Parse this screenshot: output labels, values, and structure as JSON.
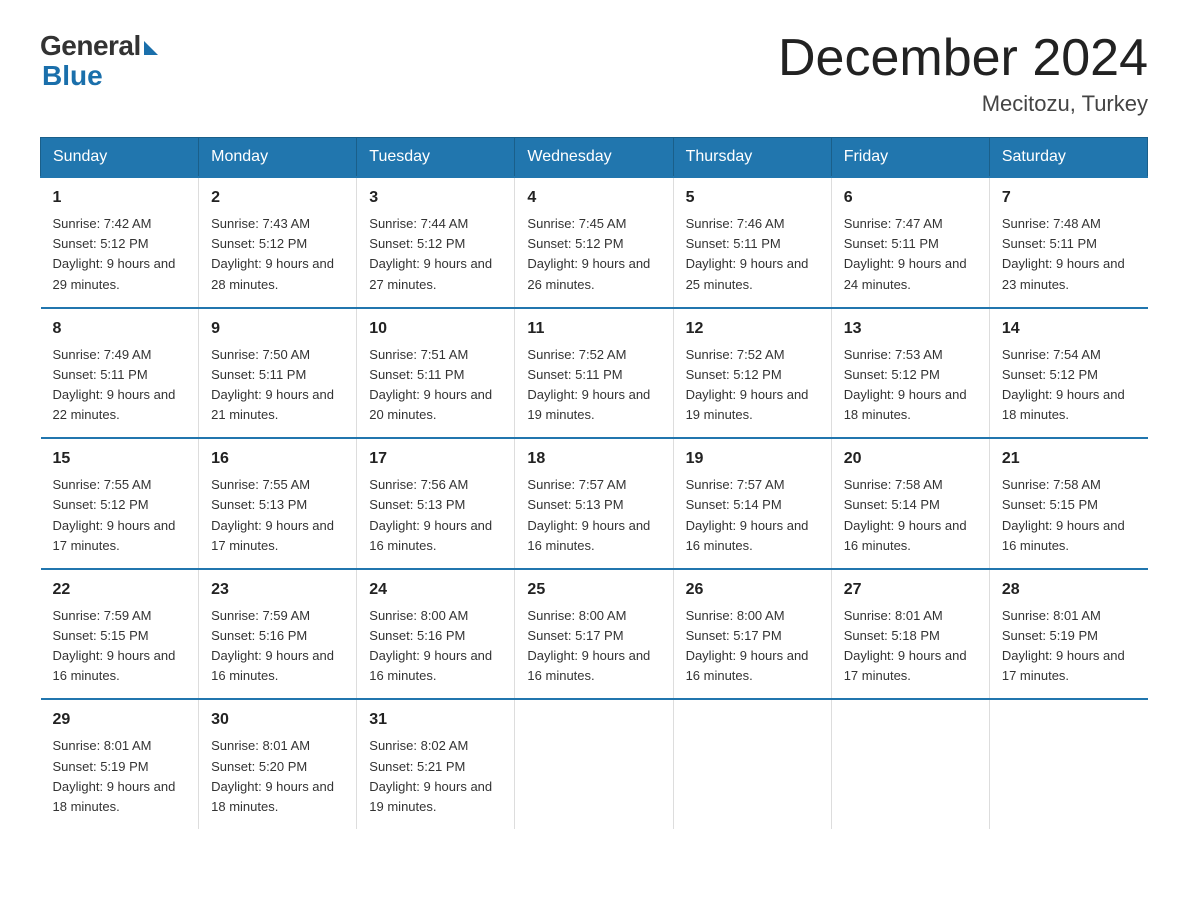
{
  "header": {
    "logo_general": "General",
    "logo_blue": "Blue",
    "title": "December 2024",
    "location": "Mecitozu, Turkey"
  },
  "days_of_week": [
    "Sunday",
    "Monday",
    "Tuesday",
    "Wednesday",
    "Thursday",
    "Friday",
    "Saturday"
  ],
  "weeks": [
    [
      {
        "day": "1",
        "sunrise": "Sunrise: 7:42 AM",
        "sunset": "Sunset: 5:12 PM",
        "daylight": "Daylight: 9 hours and 29 minutes."
      },
      {
        "day": "2",
        "sunrise": "Sunrise: 7:43 AM",
        "sunset": "Sunset: 5:12 PM",
        "daylight": "Daylight: 9 hours and 28 minutes."
      },
      {
        "day": "3",
        "sunrise": "Sunrise: 7:44 AM",
        "sunset": "Sunset: 5:12 PM",
        "daylight": "Daylight: 9 hours and 27 minutes."
      },
      {
        "day": "4",
        "sunrise": "Sunrise: 7:45 AM",
        "sunset": "Sunset: 5:12 PM",
        "daylight": "Daylight: 9 hours and 26 minutes."
      },
      {
        "day": "5",
        "sunrise": "Sunrise: 7:46 AM",
        "sunset": "Sunset: 5:11 PM",
        "daylight": "Daylight: 9 hours and 25 minutes."
      },
      {
        "day": "6",
        "sunrise": "Sunrise: 7:47 AM",
        "sunset": "Sunset: 5:11 PM",
        "daylight": "Daylight: 9 hours and 24 minutes."
      },
      {
        "day": "7",
        "sunrise": "Sunrise: 7:48 AM",
        "sunset": "Sunset: 5:11 PM",
        "daylight": "Daylight: 9 hours and 23 minutes."
      }
    ],
    [
      {
        "day": "8",
        "sunrise": "Sunrise: 7:49 AM",
        "sunset": "Sunset: 5:11 PM",
        "daylight": "Daylight: 9 hours and 22 minutes."
      },
      {
        "day": "9",
        "sunrise": "Sunrise: 7:50 AM",
        "sunset": "Sunset: 5:11 PM",
        "daylight": "Daylight: 9 hours and 21 minutes."
      },
      {
        "day": "10",
        "sunrise": "Sunrise: 7:51 AM",
        "sunset": "Sunset: 5:11 PM",
        "daylight": "Daylight: 9 hours and 20 minutes."
      },
      {
        "day": "11",
        "sunrise": "Sunrise: 7:52 AM",
        "sunset": "Sunset: 5:11 PM",
        "daylight": "Daylight: 9 hours and 19 minutes."
      },
      {
        "day": "12",
        "sunrise": "Sunrise: 7:52 AM",
        "sunset": "Sunset: 5:12 PM",
        "daylight": "Daylight: 9 hours and 19 minutes."
      },
      {
        "day": "13",
        "sunrise": "Sunrise: 7:53 AM",
        "sunset": "Sunset: 5:12 PM",
        "daylight": "Daylight: 9 hours and 18 minutes."
      },
      {
        "day": "14",
        "sunrise": "Sunrise: 7:54 AM",
        "sunset": "Sunset: 5:12 PM",
        "daylight": "Daylight: 9 hours and 18 minutes."
      }
    ],
    [
      {
        "day": "15",
        "sunrise": "Sunrise: 7:55 AM",
        "sunset": "Sunset: 5:12 PM",
        "daylight": "Daylight: 9 hours and 17 minutes."
      },
      {
        "day": "16",
        "sunrise": "Sunrise: 7:55 AM",
        "sunset": "Sunset: 5:13 PM",
        "daylight": "Daylight: 9 hours and 17 minutes."
      },
      {
        "day": "17",
        "sunrise": "Sunrise: 7:56 AM",
        "sunset": "Sunset: 5:13 PM",
        "daylight": "Daylight: 9 hours and 16 minutes."
      },
      {
        "day": "18",
        "sunrise": "Sunrise: 7:57 AM",
        "sunset": "Sunset: 5:13 PM",
        "daylight": "Daylight: 9 hours and 16 minutes."
      },
      {
        "day": "19",
        "sunrise": "Sunrise: 7:57 AM",
        "sunset": "Sunset: 5:14 PM",
        "daylight": "Daylight: 9 hours and 16 minutes."
      },
      {
        "day": "20",
        "sunrise": "Sunrise: 7:58 AM",
        "sunset": "Sunset: 5:14 PM",
        "daylight": "Daylight: 9 hours and 16 minutes."
      },
      {
        "day": "21",
        "sunrise": "Sunrise: 7:58 AM",
        "sunset": "Sunset: 5:15 PM",
        "daylight": "Daylight: 9 hours and 16 minutes."
      }
    ],
    [
      {
        "day": "22",
        "sunrise": "Sunrise: 7:59 AM",
        "sunset": "Sunset: 5:15 PM",
        "daylight": "Daylight: 9 hours and 16 minutes."
      },
      {
        "day": "23",
        "sunrise": "Sunrise: 7:59 AM",
        "sunset": "Sunset: 5:16 PM",
        "daylight": "Daylight: 9 hours and 16 minutes."
      },
      {
        "day": "24",
        "sunrise": "Sunrise: 8:00 AM",
        "sunset": "Sunset: 5:16 PM",
        "daylight": "Daylight: 9 hours and 16 minutes."
      },
      {
        "day": "25",
        "sunrise": "Sunrise: 8:00 AM",
        "sunset": "Sunset: 5:17 PM",
        "daylight": "Daylight: 9 hours and 16 minutes."
      },
      {
        "day": "26",
        "sunrise": "Sunrise: 8:00 AM",
        "sunset": "Sunset: 5:17 PM",
        "daylight": "Daylight: 9 hours and 16 minutes."
      },
      {
        "day": "27",
        "sunrise": "Sunrise: 8:01 AM",
        "sunset": "Sunset: 5:18 PM",
        "daylight": "Daylight: 9 hours and 17 minutes."
      },
      {
        "day": "28",
        "sunrise": "Sunrise: 8:01 AM",
        "sunset": "Sunset: 5:19 PM",
        "daylight": "Daylight: 9 hours and 17 minutes."
      }
    ],
    [
      {
        "day": "29",
        "sunrise": "Sunrise: 8:01 AM",
        "sunset": "Sunset: 5:19 PM",
        "daylight": "Daylight: 9 hours and 18 minutes."
      },
      {
        "day": "30",
        "sunrise": "Sunrise: 8:01 AM",
        "sunset": "Sunset: 5:20 PM",
        "daylight": "Daylight: 9 hours and 18 minutes."
      },
      {
        "day": "31",
        "sunrise": "Sunrise: 8:02 AM",
        "sunset": "Sunset: 5:21 PM",
        "daylight": "Daylight: 9 hours and 19 minutes."
      },
      {
        "day": "",
        "sunrise": "",
        "sunset": "",
        "daylight": ""
      },
      {
        "day": "",
        "sunrise": "",
        "sunset": "",
        "daylight": ""
      },
      {
        "day": "",
        "sunrise": "",
        "sunset": "",
        "daylight": ""
      },
      {
        "day": "",
        "sunrise": "",
        "sunset": "",
        "daylight": ""
      }
    ]
  ]
}
